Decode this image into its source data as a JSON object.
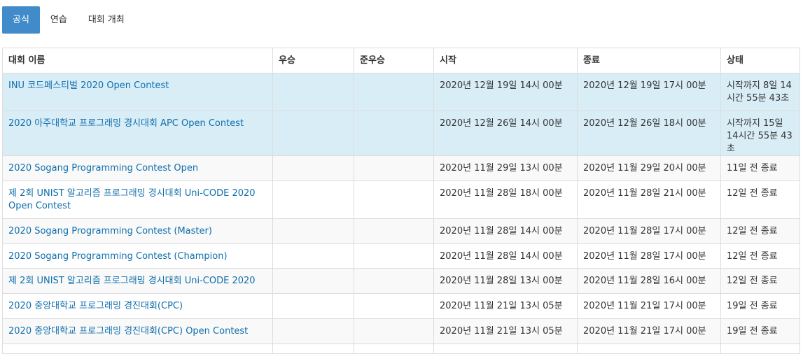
{
  "tabs": [
    {
      "label": "공식",
      "active": true
    },
    {
      "label": "연습",
      "active": false
    },
    {
      "label": "대회 개최",
      "active": false
    }
  ],
  "table": {
    "headers": [
      "대회 이름",
      "우승",
      "준우승",
      "시작",
      "종료",
      "상태"
    ],
    "rows": [
      {
        "name": "INU 코드페스티벌 2020 Open Contest",
        "winner": "",
        "runner_up": "",
        "start": "2020년 12월 19일 14시 00분",
        "end": "2020년 12월 19일 17시 00분",
        "status": "시작까지 8일 14시간 55분 43초"
      },
      {
        "name": "2020 아주대학교 프로그래밍 경시대회 APC Open Contest",
        "winner": "",
        "runner_up": "",
        "start": "2020년 12월 26일 14시 00분",
        "end": "2020년 12월 26일 18시 00분",
        "status": "시작까지 15일 14시간 55분 43초"
      },
      {
        "name": "2020 Sogang Programming Contest Open",
        "winner": "",
        "runner_up": "",
        "start": "2020년 11월 29일 13시 00분",
        "end": "2020년 11월 29일 20시 00분",
        "status": "11일 전 종료"
      },
      {
        "name": "제 2회 UNIST 알고리즘 프로그래밍 경시대회 Uni-CODE 2020 Open Contest",
        "winner": "",
        "runner_up": "",
        "start": "2020년 11월 28일 18시 00분",
        "end": "2020년 11월 28일 21시 00분",
        "status": "12일 전 종료"
      },
      {
        "name": "2020 Sogang Programming Contest (Master)",
        "winner": "",
        "runner_up": "",
        "start": "2020년 11월 28일 14시 00분",
        "end": "2020년 11월 28일 17시 00분",
        "status": "12일 전 종료"
      },
      {
        "name": "2020 Sogang Programming Contest (Champion)",
        "winner": "",
        "runner_up": "",
        "start": "2020년 11월 28일 14시 00분",
        "end": "2020년 11월 28일 17시 00분",
        "status": "12일 전 종료"
      },
      {
        "name": "제 2회 UNIST 알고리즘 프로그래밍 경시대회 Uni-CODE 2020",
        "winner": "",
        "runner_up": "",
        "start": "2020년 11월 28일 13시 00분",
        "end": "2020년 11월 28일 16시 00분",
        "status": "12일 전 종료"
      },
      {
        "name": "2020 중앙대학교 프로그래밍 경진대회(CPC)",
        "winner": "",
        "runner_up": "",
        "start": "2020년 11월 21일 13시 05분",
        "end": "2020년 11월 21일 17시 00분",
        "status": "19일 전 종료"
      },
      {
        "name": "2020 중앙대학교 프로그래밍 경진대회(CPC) Open Contest",
        "winner": "",
        "runner_up": "",
        "start": "2020년 11월 21일 13시 05분",
        "end": "2020년 11월 21일 17시 00분",
        "status": "19일 전 종료"
      }
    ]
  },
  "colors": {
    "active_tab": "#428bca",
    "link": "#0f6fac",
    "upcoming_row": "#d9edf7",
    "striped_row": "#f9f9f9",
    "border": "#dddddd"
  }
}
